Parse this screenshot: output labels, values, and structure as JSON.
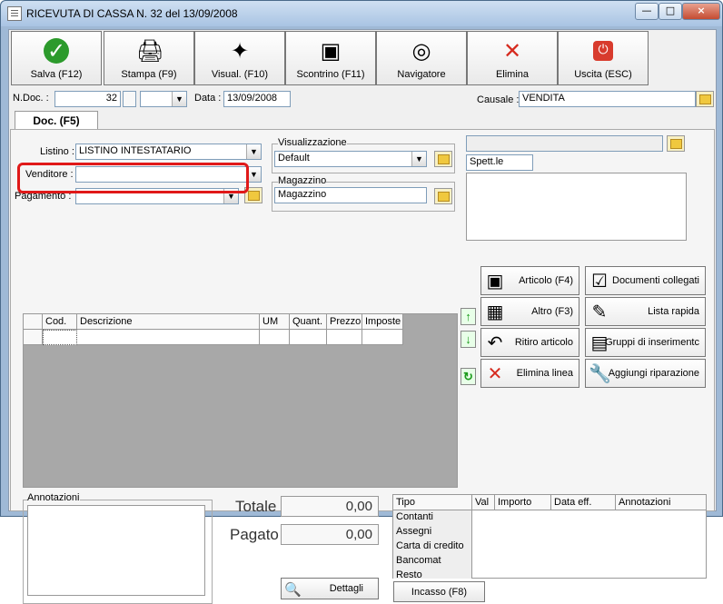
{
  "window": {
    "title": "RICEVUTA DI CASSA N. 32  del 13/09/2008"
  },
  "toolbar": [
    {
      "label": "Salva (F12)",
      "icon": "checkmark-icon"
    },
    {
      "label": "Stampa (F9)",
      "icon": "printer-icon"
    },
    {
      "label": "Visual. (F10)",
      "icon": "magic-wand-icon"
    },
    {
      "label": "Scontrino (F11)",
      "icon": "cash-register-icon"
    },
    {
      "label": "Navigatore",
      "icon": "compass-icon"
    },
    {
      "label": "Elimina",
      "icon": "delete-x-icon"
    },
    {
      "label": "Uscita (ESC)",
      "icon": "exit-icon"
    }
  ],
  "header": {
    "ndoc_label": "N.Doc. :",
    "ndoc_value": "32",
    "data_label": "Data :",
    "data_value": "13/09/2008",
    "causale_label": "Causale :",
    "causale_value": "VENDITA"
  },
  "tab": {
    "label": "Doc. (F5)"
  },
  "form": {
    "listino_label": "Listino :",
    "listino_value": "LISTINO INTESTATARIO",
    "venditore_label": "Venditore :",
    "venditore_value": "",
    "pagamento_label": "Pagamento :",
    "pagamento_value": "",
    "visualizzazione_title": "Visualizzazione",
    "visualizzazione_value": "Default",
    "magazzino_title": "Magazzino",
    "magazzino_value": "Magazzino",
    "spett_value": "Spett.le"
  },
  "grid": {
    "columns": [
      "Cod.",
      "Descrizione",
      "UM",
      "Quant.",
      "Prezzo",
      "Imposte"
    ]
  },
  "actions": [
    {
      "label": "Articolo (F4)",
      "icon": "article-add-icon"
    },
    {
      "label": "Documenti collegati",
      "icon": "linked-documents-icon"
    },
    {
      "label": "Altro (F3)",
      "icon": "other-add-icon"
    },
    {
      "label": "Lista rapida",
      "icon": "quick-list-icon"
    },
    {
      "label": "Ritiro articolo",
      "icon": "return-article-icon"
    },
    {
      "label": "Gruppi di inserimentc",
      "icon": "insert-groups-icon"
    },
    {
      "label": "Elimina linea",
      "icon": "delete-line-icon"
    },
    {
      "label": "Aggiungi riparazione",
      "icon": "repair-wrench-icon"
    }
  ],
  "annotations": {
    "title": "Annotazioni"
  },
  "totals": {
    "totale_label": "Totale",
    "totale_value": "0,00",
    "pagato_label": "Pagato",
    "pagato_value": "0,00",
    "dettagli_label": "Dettagli"
  },
  "payment": {
    "headers": [
      "Tipo",
      "Val",
      "Importo",
      "Data eff.",
      "Annotazioni"
    ],
    "types": [
      "Contanti",
      "Assegni",
      "Carta di credito",
      "Bancomat",
      "Resto"
    ],
    "incasso_label": "Incasso (F8)"
  }
}
